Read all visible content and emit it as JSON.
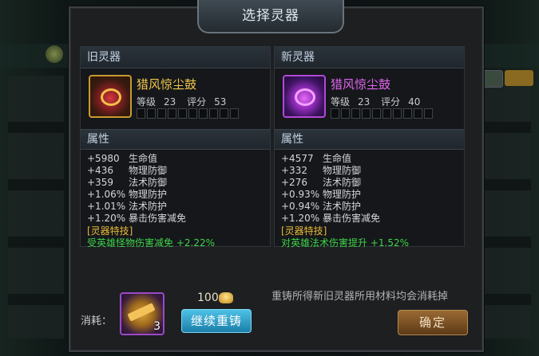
{
  "title": "选择灵器",
  "old_panel": {
    "header": "旧灵器",
    "item_name": "猎风惊尘鼓",
    "level_label": "等级",
    "level": "23",
    "score_label": "评分",
    "score": "53",
    "attr_header": "属性",
    "stats": [
      {
        "value": "+5980",
        "name": "生命值"
      },
      {
        "value": "+436",
        "name": "物理防御"
      },
      {
        "value": "+359",
        "name": "法术防御"
      },
      {
        "value": "+1.06%",
        "name": "物理防护"
      },
      {
        "value": "+1.01%",
        "name": "法术防护"
      },
      {
        "value": "+1.20%",
        "name": "暴击伤害减免"
      }
    ],
    "skill_title": "[灵器特技]",
    "skill_desc": "受英雄怪物伤害减免 +2.22%",
    "rarity_color": "#f2c84b"
  },
  "new_panel": {
    "header": "新灵器",
    "item_name": "猎风惊尘鼓",
    "level_label": "等级",
    "level": "23",
    "score_label": "评分",
    "score": "40",
    "attr_header": "属性",
    "stats": [
      {
        "value": "+4577",
        "name": "生命值"
      },
      {
        "value": "+332",
        "name": "物理防御"
      },
      {
        "value": "+276",
        "name": "法术防御"
      },
      {
        "value": "+0.93%",
        "name": "物理防护"
      },
      {
        "value": "+0.94%",
        "name": "法术防护"
      },
      {
        "value": "+1.20%",
        "name": "暴击伤害减免"
      }
    ],
    "skill_title": "[灵器特技]",
    "skill_desc": "对英雄法术伤害提升 +1.52%",
    "rarity_color": "#e266f2"
  },
  "footer": {
    "note": "重铸所得新旧灵器所用材料均会消耗掉",
    "cost_label": "消耗：",
    "cost_count": "3",
    "price": "100",
    "price_icon": "gold-ingot-icon",
    "recast_button": "继续重铸",
    "confirm_button": "确定"
  }
}
